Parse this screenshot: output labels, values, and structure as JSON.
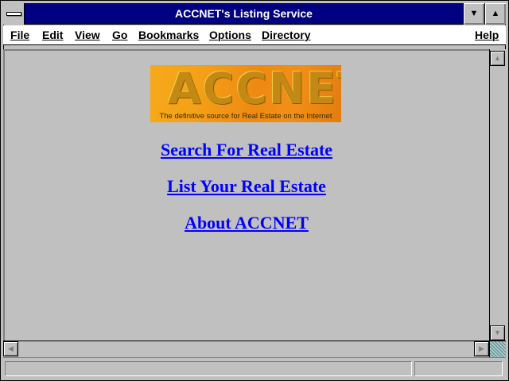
{
  "window": {
    "title": "ACCNET's Listing Service"
  },
  "menubar": {
    "items": [
      {
        "key": "F",
        "rest": "ile"
      },
      {
        "key": "E",
        "rest": "dit"
      },
      {
        "key": "V",
        "rest": "iew"
      },
      {
        "key": "G",
        "rest": "o"
      },
      {
        "key": "B",
        "rest": "ookmarks"
      },
      {
        "key": "O",
        "rest": "ptions"
      },
      {
        "key": "D",
        "rest": "irectory"
      },
      {
        "key": "H",
        "rest": "elp"
      }
    ]
  },
  "page": {
    "logo": {
      "word": "ACCNET",
      "tagline": "The definitive source for Real Estate on the Internet"
    },
    "links": [
      "Search For Real Estate",
      "List Your Real Estate",
      "About ACCNET"
    ]
  },
  "statusbar": {
    "text": "",
    "progress": ""
  },
  "colors": {
    "titlebar": "#000080",
    "link": "#0000ff",
    "window_bg": "#c0c0c0",
    "logo_orange": "#f4a118"
  },
  "icons": {
    "system_menu": "system-menu-icon",
    "minimize": "minimize-arrow-icon",
    "maximize": "maximize-arrow-icon",
    "scroll_up": "scroll-up-arrow-icon",
    "scroll_down": "scroll-down-arrow-icon",
    "scroll_left": "scroll-left-arrow-icon",
    "scroll_right": "scroll-right-arrow-icon"
  }
}
